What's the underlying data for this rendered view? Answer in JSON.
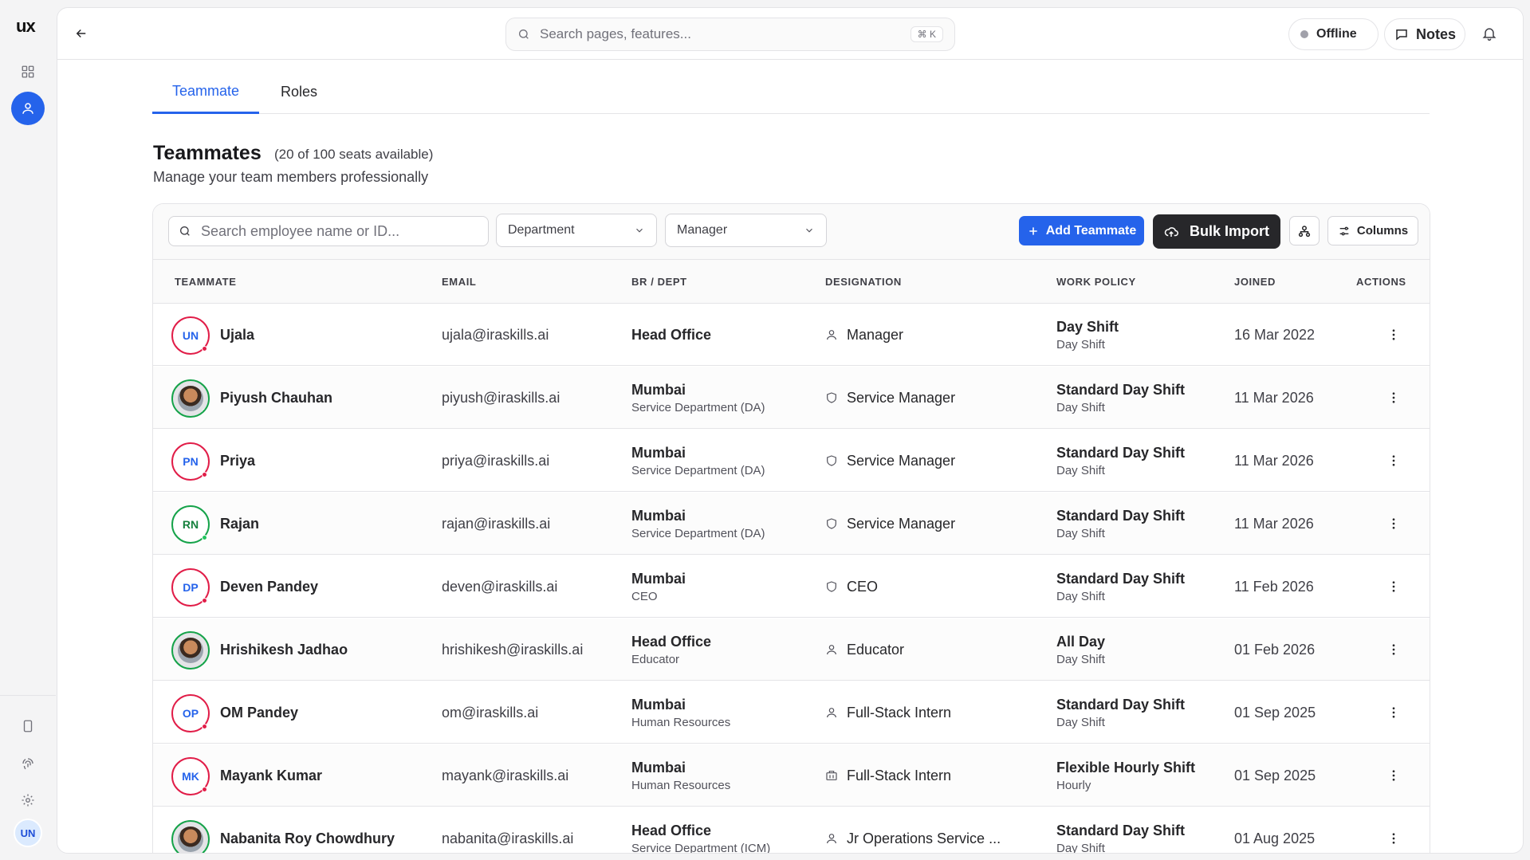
{
  "app": {
    "logo": "ux"
  },
  "search": {
    "placeholder": "Search pages, features...",
    "shortcut": "⌘ K"
  },
  "header": {
    "status": "Offline",
    "notes_label": "Notes"
  },
  "tabs": [
    {
      "label": "Teammate",
      "active": true
    },
    {
      "label": "Roles",
      "active": false
    }
  ],
  "page": {
    "title": "Teammates",
    "seats": "(20 of 100 seats available)",
    "subtitle": "Manage your team members professionally"
  },
  "filters": {
    "search_placeholder": "Search employee name or ID...",
    "department": "Department",
    "manager": "Manager",
    "add_label": "Add Teammate",
    "bulk_label": "Bulk Import",
    "columns_label": "Columns"
  },
  "table": {
    "headers": [
      "TEAMMATE",
      "EMAIL",
      "BR / DEPT",
      "DESIGNATION",
      "WORK POLICY",
      "JOINED",
      "ACTIONS"
    ],
    "rows": [
      {
        "initials": "UN",
        "name": "Ujala",
        "email": "ujala@iraskills.ai",
        "branch": "Head Office",
        "dept": "",
        "designation": "Manager",
        "desig_icon": "user-icon",
        "policy": "Day Shift",
        "policy_sub": "Day Shift",
        "joined": "16 Mar 2022",
        "ring": "#e11d48",
        "avatar_type": "initials",
        "status_color": "#e11d48"
      },
      {
        "initials": "",
        "name": "Piyush Chauhan",
        "email": "piyush@iraskills.ai",
        "branch": "Mumbai",
        "dept": "Service Department (DA)",
        "designation": "Service Manager",
        "desig_icon": "shield-icon",
        "policy": "Standard Day Shift",
        "policy_sub": "Day Shift",
        "joined": "11 Mar 2026",
        "ring": "#16a34a",
        "avatar_type": "photo",
        "status_color": "#22c55e"
      },
      {
        "initials": "PN",
        "name": "Priya",
        "email": "priya@iraskills.ai",
        "branch": "Mumbai",
        "dept": "Service Department (DA)",
        "designation": "Service Manager",
        "desig_icon": "shield-icon",
        "policy": "Standard Day Shift",
        "policy_sub": "Day Shift",
        "joined": "11 Mar 2026",
        "ring": "#e11d48",
        "avatar_type": "initials",
        "status_color": "#e11d48"
      },
      {
        "initials": "RN",
        "name": "Rajan",
        "email": "rajan@iraskills.ai",
        "branch": "Mumbai",
        "dept": "Service Department (DA)",
        "designation": "Service Manager",
        "desig_icon": "shield-icon",
        "policy": "Standard Day Shift",
        "policy_sub": "Day Shift",
        "joined": "11 Mar 2026",
        "ring": "#16a34a",
        "avatar_type": "initials",
        "status_color": "#22c55e"
      },
      {
        "initials": "DP",
        "name": "Deven Pandey",
        "email": "deven@iraskills.ai",
        "branch": "Mumbai",
        "dept": "CEO",
        "designation": "CEO",
        "desig_icon": "shield-icon",
        "policy": "Standard Day Shift",
        "policy_sub": "Day Shift",
        "joined": "11 Feb 2026",
        "ring": "#e11d48",
        "avatar_type": "initials",
        "status_color": "#e11d48"
      },
      {
        "initials": "",
        "name": "Hrishikesh Jadhao",
        "email": "hrishikesh@iraskills.ai",
        "branch": "Head Office",
        "dept": "Educator",
        "designation": "Educator",
        "desig_icon": "user-icon",
        "policy": "All Day",
        "policy_sub": "Day Shift",
        "joined": "01 Feb 2026",
        "ring": "#16a34a",
        "avatar_type": "photo",
        "status_color": "#22c55e"
      },
      {
        "initials": "OP",
        "name": "OM Pandey",
        "email": "om@iraskills.ai",
        "branch": "Mumbai",
        "dept": "Human Resources",
        "designation": "Full-Stack Intern",
        "desig_icon": "user-icon",
        "policy": "Standard Day Shift",
        "policy_sub": "Day Shift",
        "joined": "01 Sep 2025",
        "ring": "#e11d48",
        "avatar_type": "initials",
        "status_color": "#e11d48"
      },
      {
        "initials": "MK",
        "name": "Mayank Kumar",
        "email": "mayank@iraskills.ai",
        "branch": "Mumbai",
        "dept": "Human Resources",
        "designation": "Full-Stack Intern",
        "desig_icon": "building-icon",
        "policy": "Flexible Hourly Shift",
        "policy_sub": "Hourly",
        "joined": "01 Sep 2025",
        "ring": "#e11d48",
        "avatar_type": "initials",
        "status_color": "#e11d48"
      },
      {
        "initials": "",
        "name": "Nabanita Roy Chowdhury",
        "email": "nabanita@iraskills.ai",
        "branch": "Head Office",
        "dept": "Service Department (ICM)",
        "designation": "Jr Operations Service ...",
        "desig_icon": "user-icon",
        "policy": "Standard Day Shift",
        "policy_sub": "Day Shift",
        "joined": "01 Aug 2025",
        "ring": "#16a34a",
        "avatar_type": "photo",
        "status_color": "#22c55e"
      }
    ]
  },
  "user": {
    "initials": "UN"
  },
  "colors": {
    "accent": "#2563eb",
    "dark_button": "#27272a"
  }
}
